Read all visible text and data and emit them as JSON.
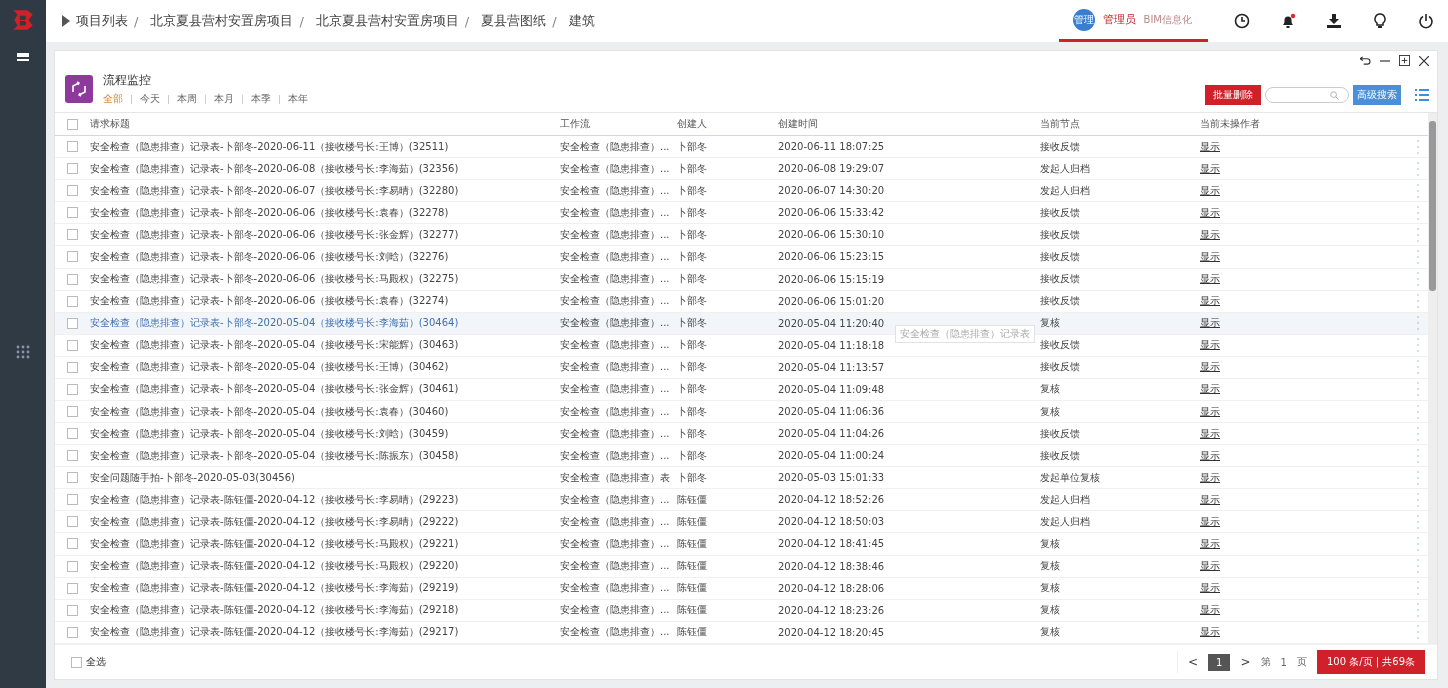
{
  "breadcrumb": [
    {
      "label": "项目列表",
      "separator": "/"
    },
    {
      "label": "北京夏县营村安置房项目",
      "separator": "/"
    },
    {
      "label": "北京夏县营村安置房项目",
      "separator": "/"
    },
    {
      "label": "夏县营图纸",
      "separator": "/"
    },
    {
      "label": "建筑"
    }
  ],
  "user": {
    "avatar": "管理",
    "name": "管理员",
    "org": "BIM信息化"
  },
  "notifications": {
    "unread": true
  },
  "module": {
    "title": "流程监控",
    "filters": [
      {
        "label": "全部",
        "selected": true
      },
      {
        "label": "今天",
        "selected": false
      },
      {
        "label": "本周",
        "selected": false
      },
      {
        "label": "本月",
        "selected": false
      },
      {
        "label": "本季",
        "selected": false
      },
      {
        "label": "本年",
        "selected": false
      }
    ]
  },
  "toolbar": {
    "delete_button": "批量删除",
    "search": {
      "kind": "field"
    },
    "advanced_button": "高级搜索"
  },
  "table": {
    "header_checkbox": {
      "checked": false
    },
    "columns": [
      "请求标题",
      "工作流",
      "创建人",
      "创建时间",
      "当前节点",
      "当前未操作者"
    ],
    "rows": [
      {
        "title": "安全检查（隐患排查）记录表-卜部冬-2020-06-11（接收楼号长:王博）(32511)",
        "workflow": "安全检查（隐患排查）...",
        "creator": "卜部冬",
        "created": "2020-06-11 18:07:25",
        "node": "接收反馈",
        "handler": "显示",
        "checked": false,
        "selected": false
      },
      {
        "title": "安全检查（隐患排查）记录表-卜部冬-2020-06-08（接收楼号长:李海茹）(32356)",
        "workflow": "安全检查（隐患排查）...",
        "creator": "卜部冬",
        "created": "2020-06-08 19:29:07",
        "node": "发起人归档",
        "handler": "显示",
        "checked": false,
        "selected": false
      },
      {
        "title": "安全检查（隐患排查）记录表-卜部冬-2020-06-07（接收楼号长:李易晴）(32280)",
        "workflow": "安全检查（隐患排查）...",
        "creator": "卜部冬",
        "created": "2020-06-07 14:30:20",
        "node": "发起人归档",
        "handler": "显示",
        "checked": false,
        "selected": false
      },
      {
        "title": "安全检查（隐患排查）记录表-卜部冬-2020-06-06（接收楼号长:袁春）(32278)",
        "workflow": "安全检查（隐患排查）...",
        "creator": "卜部冬",
        "created": "2020-06-06 15:33:42",
        "node": "接收反馈",
        "handler": "显示",
        "checked": false,
        "selected": false
      },
      {
        "title": "安全检查（隐患排查）记录表-卜部冬-2020-06-06（接收楼号长:张金辉）(32277)",
        "workflow": "安全检查（隐患排查）...",
        "creator": "卜部冬",
        "created": "2020-06-06 15:30:10",
        "node": "接收反馈",
        "handler": "显示",
        "checked": false,
        "selected": false
      },
      {
        "title": "安全检查（隐患排查）记录表-卜部冬-2020-06-06（接收楼号长:刘晗）(32276)",
        "workflow": "安全检查（隐患排查）...",
        "creator": "卜部冬",
        "created": "2020-06-06 15:23:15",
        "node": "接收反馈",
        "handler": "显示",
        "checked": false,
        "selected": false
      },
      {
        "title": "安全检查（隐患排查）记录表-卜部冬-2020-06-06（接收楼号长:马殿权）(32275)",
        "workflow": "安全检查（隐患排查）...",
        "creator": "卜部冬",
        "created": "2020-06-06 15:15:19",
        "node": "接收反馈",
        "handler": "显示",
        "checked": false,
        "selected": false
      },
      {
        "title": "安全检查（隐患排查）记录表-卜部冬-2020-06-06（接收楼号长:袁春）(32274)",
        "workflow": "安全检查（隐患排查）...",
        "creator": "卜部冬",
        "created": "2020-06-06 15:01:20",
        "node": "接收反馈",
        "handler": "显示",
        "checked": false,
        "selected": false
      },
      {
        "title": "安全检查（隐患排查）记录表-卜部冬-2020-05-04（接收楼号长:李海茹）(30464)",
        "workflow": "安全检查（隐患排查）...",
        "creator": "卜部冬",
        "created": "2020-05-04 11:20:40",
        "node": "复核",
        "handler": "显示",
        "checked": false,
        "selected": true,
        "tooltip": "安全检查（隐患排查）记录表"
      },
      {
        "title": "安全检查（隐患排查）记录表-卜部冬-2020-05-04（接收楼号长:宋能辉）(30463)",
        "workflow": "安全检查（隐患排查）...",
        "creator": "卜部冬",
        "created": "2020-05-04 11:18:18",
        "node": "接收反馈",
        "handler": "显示",
        "checked": false,
        "selected": false
      },
      {
        "title": "安全检查（隐患排查）记录表-卜部冬-2020-05-04（接收楼号长:王博）(30462)",
        "workflow": "安全检查（隐患排查）...",
        "creator": "卜部冬",
        "created": "2020-05-04 11:13:57",
        "node": "接收反馈",
        "handler": "显示",
        "checked": false,
        "selected": false
      },
      {
        "title": "安全检查（隐患排查）记录表-卜部冬-2020-05-04（接收楼号长:张金辉）(30461)",
        "workflow": "安全检查（隐患排查）...",
        "creator": "卜部冬",
        "created": "2020-05-04 11:09:48",
        "node": "复核",
        "handler": "显示",
        "checked": false,
        "selected": false
      },
      {
        "title": "安全检查（隐患排查）记录表-卜部冬-2020-05-04（接收楼号长:袁春）(30460)",
        "workflow": "安全检查（隐患排查）...",
        "creator": "卜部冬",
        "created": "2020-05-04 11:06:36",
        "node": "复核",
        "handler": "显示",
        "checked": false,
        "selected": false
      },
      {
        "title": "安全检查（隐患排查）记录表-卜部冬-2020-05-04（接收楼号长:刘晗）(30459)",
        "workflow": "安全检查（隐患排查）...",
        "creator": "卜部冬",
        "created": "2020-05-04 11:04:26",
        "node": "接收反馈",
        "handler": "显示",
        "checked": false,
        "selected": false
      },
      {
        "title": "安全检查（隐患排查）记录表-卜部冬-2020-05-04（接收楼号长:陈振东）(30458)",
        "workflow": "安全检查（隐患排查）...",
        "creator": "卜部冬",
        "created": "2020-05-04 11:00:24",
        "node": "接收反馈",
        "handler": "显示",
        "checked": false,
        "selected": false
      },
      {
        "title": "安全问题随手拍-卜部冬-2020-05-03(30456)",
        "workflow": "安全检查（隐患排查）表",
        "creator": "卜部冬",
        "created": "2020-05-03 15:01:33",
        "node": "发起单位复核",
        "handler": "显示",
        "checked": false,
        "selected": false
      },
      {
        "title": "安全检查（隐患排查）记录表-陈钰僵-2020-04-12（接收楼号长:李易晴）(29223)",
        "workflow": "安全检查（隐患排查）...",
        "creator": "陈钰僵",
        "created": "2020-04-12 18:52:26",
        "node": "发起人归档",
        "handler": "显示",
        "checked": false,
        "selected": false
      },
      {
        "title": "安全检查（隐患排查）记录表-陈钰僵-2020-04-12（接收楼号长:李易晴）(29222)",
        "workflow": "安全检查（隐患排查）...",
        "creator": "陈钰僵",
        "created": "2020-04-12 18:50:03",
        "node": "发起人归档",
        "handler": "显示",
        "checked": false,
        "selected": false
      },
      {
        "title": "安全检查（隐患排查）记录表-陈钰僵-2020-04-12（接收楼号长:马殿权）(29221)",
        "workflow": "安全检查（隐患排查）...",
        "creator": "陈钰僵",
        "created": "2020-04-12 18:41:45",
        "node": "复核",
        "handler": "显示",
        "checked": false,
        "selected": false
      },
      {
        "title": "安全检查（隐患排查）记录表-陈钰僵-2020-04-12（接收楼号长:马殿权）(29220)",
        "workflow": "安全检查（隐患排查）...",
        "creator": "陈钰僵",
        "created": "2020-04-12 18:38:46",
        "node": "复核",
        "handler": "显示",
        "checked": false,
        "selected": false
      },
      {
        "title": "安全检查（隐患排查）记录表-陈钰僵-2020-04-12（接收楼号长:李海茹）(29219)",
        "workflow": "安全检查（隐患排查）...",
        "creator": "陈钰僵",
        "created": "2020-04-12 18:28:06",
        "node": "复核",
        "handler": "显示",
        "checked": false,
        "selected": false
      },
      {
        "title": "安全检查（隐患排查）记录表-陈钰僵-2020-04-12（接收楼号长:李海茹）(29218)",
        "workflow": "安全检查（隐患排查）...",
        "creator": "陈钰僵",
        "created": "2020-04-12 18:23:26",
        "node": "复核",
        "handler": "显示",
        "checked": false,
        "selected": false
      },
      {
        "title": "安全检查（隐患排查）记录表-陈钰僵-2020-04-12（接收楼号长:李海茹）(29217)",
        "workflow": "安全检查（隐患排查）...",
        "creator": "陈钰僵",
        "created": "2020-04-12 18:20:45",
        "node": "复核",
        "handler": "显示",
        "checked": false,
        "selected": false
      }
    ]
  },
  "footer": {
    "select_all": {
      "label": "全选",
      "checked": false
    },
    "pager": {
      "prev": "<",
      "pages": [
        {
          "label": "1",
          "selected": true
        }
      ],
      "next": ">",
      "page_prefix": "第",
      "page_input": "1",
      "page_suffix": "页",
      "summary": "100 条/页 | 共69条"
    }
  }
}
